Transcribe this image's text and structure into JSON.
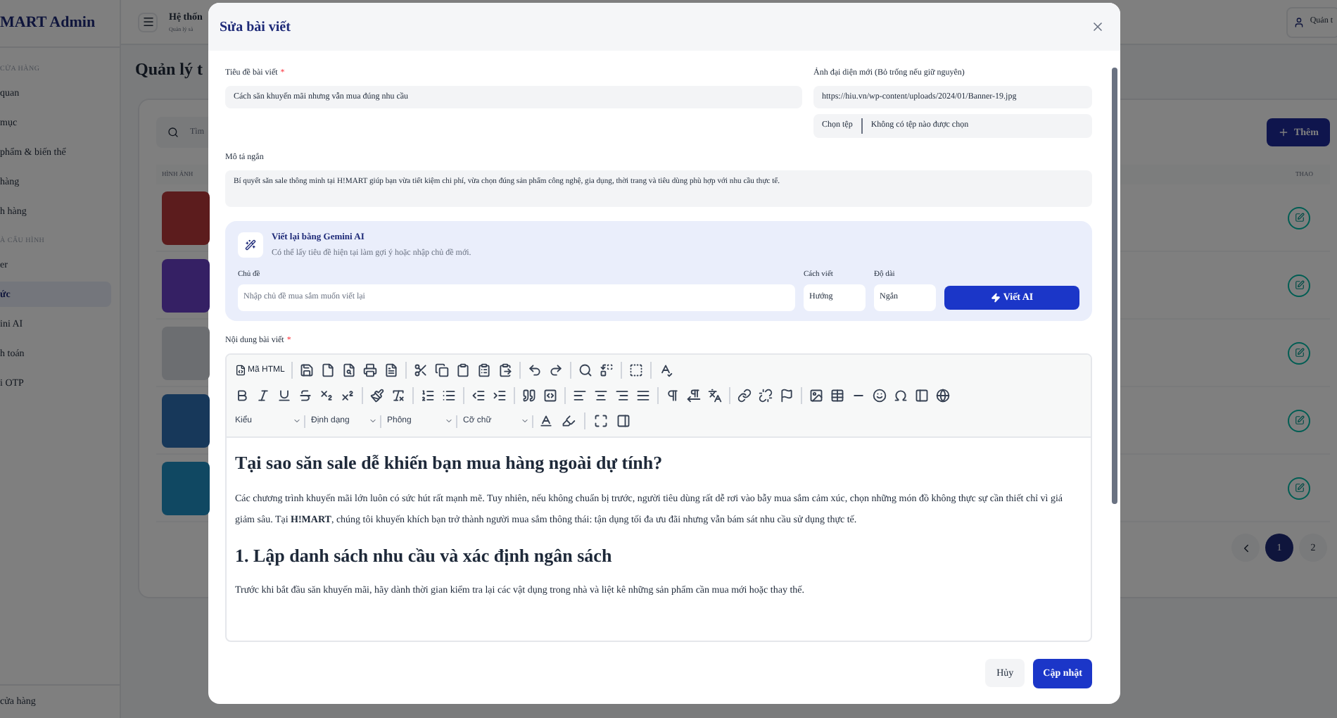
{
  "sidebar": {
    "brand": "MART Admin",
    "sections": [
      {
        "heading": "CỬA HÀNG",
        "items": [
          {
            "label": "quan",
            "selected": false
          },
          {
            "label": "mục",
            "selected": false
          },
          {
            "label": "phẩm & biến thể",
            "selected": false
          },
          {
            "label": "hàng",
            "selected": false
          },
          {
            "label": "h hàng",
            "selected": false
          }
        ]
      },
      {
        "heading": "À CẤU HÌNH",
        "items": [
          {
            "label": "er",
            "selected": false
          },
          {
            "label": "ức",
            "selected": true
          },
          {
            "label": "ini AI",
            "selected": false
          },
          {
            "label": "h toán",
            "selected": false
          },
          {
            "label": "i OTP",
            "selected": false
          }
        ]
      }
    ],
    "footer": "cửa hàng"
  },
  "header": {
    "title": "Hệ thốn",
    "subtitle": "Quản lý sả",
    "user": "Quản t"
  },
  "page": {
    "title": "Quản lý t",
    "search_placeholder": "Tìm",
    "add_button": "Thêm",
    "columns": [
      "HÌNH ẢNH",
      "THAO"
    ],
    "rows": [
      {
        "color": "#5c1c1d"
      },
      {
        "color": "#352064"
      },
      {
        "color": "#6c6e71"
      },
      {
        "color": "#17385a"
      },
      {
        "color": "#104862"
      }
    ],
    "pagination": [
      {
        "label": "1",
        "selected": true
      },
      {
        "label": "2",
        "selected": false
      }
    ]
  },
  "modal": {
    "title": "Sửa bài viết",
    "title_field": {
      "label": "Tiêu đề bài viết",
      "required_mark": "*",
      "value": "Cách săn khuyến mãi nhưng vẫn mua đúng nhu cầu"
    },
    "image_field": {
      "label": "Ảnh đại diện mới (Bỏ trống nếu giữ nguyên)",
      "value": "https://hiu.vn/wp-content/uploads/2024/01/Banner-19.jpg",
      "file_button": "Chọn tệp",
      "file_status": "Không có tệp nào được chọn"
    },
    "summary_field": {
      "label": "Mô tả ngắn",
      "value": "Bí quyết săn sale thông minh tại H!MART giúp bạn vừa tiết kiệm chi phí, vừa chọn đúng sản phẩm công nghệ, gia dụng, thời trang và tiêu dùng phù hợp với nhu cầu thực tế."
    },
    "ai": {
      "title": "Viết lại bằng Gemini AI",
      "subtitle": "Có thể lấy tiêu đề hiện tại làm gợi ý hoặc nhập chủ đề mới.",
      "topic_label": "Chủ đề",
      "topic_placeholder": "Nhập chủ đề mua sắm muốn viết lại",
      "style_label": "Cách viết",
      "style_value": "Hướng",
      "length_label": "Độ dài",
      "length_value": "Ngắn",
      "button": "Viết AI"
    },
    "content_label": "Nội dung bài viết",
    "content_required_mark": "*",
    "toolbar": {
      "html_button": "Mã HTML",
      "dropdowns": [
        "Kiểu",
        "Định dạng",
        "Phông",
        "Cỡ chữ"
      ]
    },
    "document": [
      {
        "kind": "heading",
        "text": "Tại sao săn sale dễ khiến bạn mua hàng ngoài dự tính?"
      },
      {
        "kind": "paragraph",
        "text": "Các chương trình khuyến mãi lớn luôn có sức hút rất mạnh mẽ. Tuy nhiên, nếu không chuẩn bị trước, người tiêu dùng rất dễ rơi vào bẫy mua sắm cảm xúc, chọn những món đồ không thực sự cần thiết chỉ vì giá giảm sâu. Tại **H!MART**, chúng tôi khuyến khích bạn trở thành người mua sắm thông thái: tận dụng tối đa ưu đãi nhưng vẫn bám sát nhu cầu sử dụng thực tế."
      },
      {
        "kind": "heading",
        "text": "1. Lập danh sách nhu cầu và xác định ngân sách"
      },
      {
        "kind": "paragraph",
        "text": "Trước khi bắt đầu săn khuyến mãi, hãy dành thời gian kiểm tra lại các vật dụng trong nhà và liệt kê những sản phẩm cần mua mới hoặc thay thế."
      }
    ],
    "cancel_button": "Hủy",
    "submit_button": "Cập nhật"
  }
}
